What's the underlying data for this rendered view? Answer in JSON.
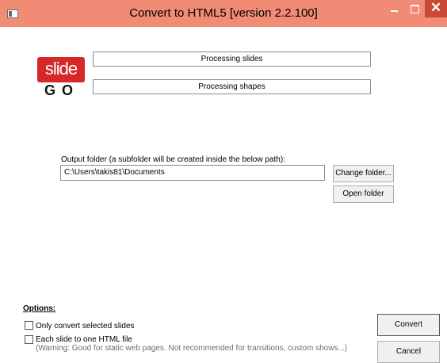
{
  "window": {
    "title": "Convert to HTML5 [version 2.2.100]",
    "close_glyph": "✕"
  },
  "logo": {
    "text_top": "slide",
    "text_bottom": "GO"
  },
  "status": {
    "line1": "Processing slides",
    "line2": "Processing shapes"
  },
  "output": {
    "label": "Output folder (a subfolder will be created inside the below path):",
    "path_value": "C:\\Users\\takis81\\Documents",
    "change_folder_label": "Change folder...",
    "open_folder_label": "Open folder"
  },
  "options": {
    "heading": "Options:",
    "only_selected_label": "Only convert selected slides",
    "only_selected_checked": false,
    "each_slide_label": "Each slide to one HTML file",
    "each_slide_checked": false,
    "each_slide_warning": "(Warning: Good for static web pages. Not recommended for transitions, custom shows...)"
  },
  "actions": {
    "convert_label": "Convert",
    "cancel_label": "Cancel"
  },
  "colors": {
    "titlebar": "#f28b76",
    "close_button": "#c84a34",
    "logo_red": "#d62828"
  }
}
